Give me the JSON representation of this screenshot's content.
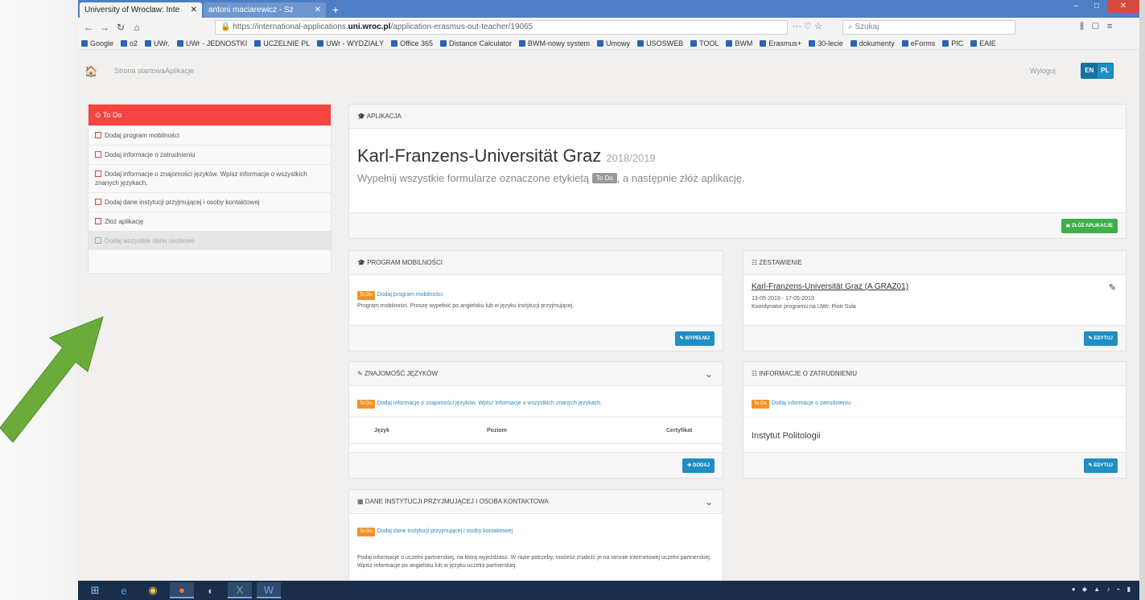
{
  "browser": {
    "tabs": [
      {
        "label": "University of Wroclaw: Inte",
        "active": true
      },
      {
        "label": "antoni maciarewicz - Sz",
        "active": false
      }
    ],
    "new_tab": "+",
    "url_prefix": "https://international-applications.",
    "url_domain": "uni.wroc.pl",
    "url_path": "/application-erasmus-out-teacher/19065",
    "search_placeholder": "Szukaj",
    "bookmarks": [
      "Google",
      "o2",
      "UWr.",
      "UWr - JEDNOSTKI",
      "UCZELNIE PL",
      "UWr - WYDZIAŁY",
      "Office 365",
      "Distance Calculator",
      "BWM-nowy system",
      "Umowy",
      "USOSWEB",
      "TOOL",
      "BWM",
      "Erasmus+",
      "30-lecie",
      "dokumenty",
      "eForms",
      "PIC",
      "EAIE"
    ]
  },
  "site": {
    "crumb1": "Strona startowa",
    "crumb2": "Aplikacje",
    "logout": "Wyloguj",
    "lang_en": "EN",
    "lang_pl": "PL"
  },
  "sidebar": {
    "head": "To Do",
    "items": [
      "Dodaj program mobilności",
      "Dodaj informacje o zatrudnieniu",
      "Dodaj informacje o znajomości języków. Wpisz informacje o wszystkich znanych językach.",
      "Dodaj dane instytucji przyjmującej i osoby kontaktowej",
      "Złóż aplikację"
    ],
    "disabled_item": "Dodaj wszystkie dane osobowe"
  },
  "application": {
    "header": "APLIKACJA",
    "university": "Karl-Franzens-Universität Graz",
    "year": "2018/2019",
    "sub_before": "Wypełnij wszystkie formularze oznaczone etykietą",
    "sub_label": "To Do",
    "sub_after": ", a następnie złóż aplikację.",
    "submit": "ZŁÓŻ APLIKACJĘ"
  },
  "mobility": {
    "header": "PROGRAM MOBILNOŚCI",
    "todo": "To Do",
    "link": "Dodaj program mobilności",
    "text": "Program mobilności. Proszę wypełnić po angielsku lub w języku instytucji przyjmującej.",
    "button": "WYPEŁNIJ"
  },
  "summary": {
    "header": "ZESTAWIENIE",
    "title": "Karl-Franzens-Universität Graz (A GRAZ01)",
    "dates": "13-05-2019 - 17-05-2019",
    "coordinator": "Koordynator programu na UWr: Piotr Sula",
    "button": "EDYTUJ"
  },
  "languages": {
    "header": "ZNAJOMOŚĆ JĘZYKÓW",
    "todo": "To Do",
    "link": "Dodaj informacje o znajomości języków. Wpisz informacje o wszystkich znanych językach.",
    "col1": "Język",
    "col2": "Poziom",
    "col3": "Certyfikat",
    "button": "DODAJ"
  },
  "employment": {
    "header": "INFORMACJE O ZATRUDNIENIU",
    "todo": "To Do",
    "link": "Dodaj informacje o zatrudnieniu",
    "value": "Instytut Politologii",
    "button": "EDYTUJ"
  },
  "institution": {
    "header": "DANE INSTYTUCJI PRZYJMUJĄCEJ I OSOBA KONTAKTOWA",
    "todo": "To Do",
    "link": "Dodaj dane instytucji przyjmującej i osoby kontaktowej",
    "text": "Podaj informacje o uczelni partnerskiej, na którą wyjeżdżasz. W razie potrzeby, możesz znaleźć je na stronie internetowej uczelni partnerskiej. Wpisz informacje po angielsku lub w języku uczelni partnerskiej."
  },
  "colors": {
    "accent": "#f2453f",
    "primary": "#1e8ec4",
    "success": "#3cb04a",
    "todo": "#f59127",
    "annotation_arrow": "#6aab3a"
  }
}
